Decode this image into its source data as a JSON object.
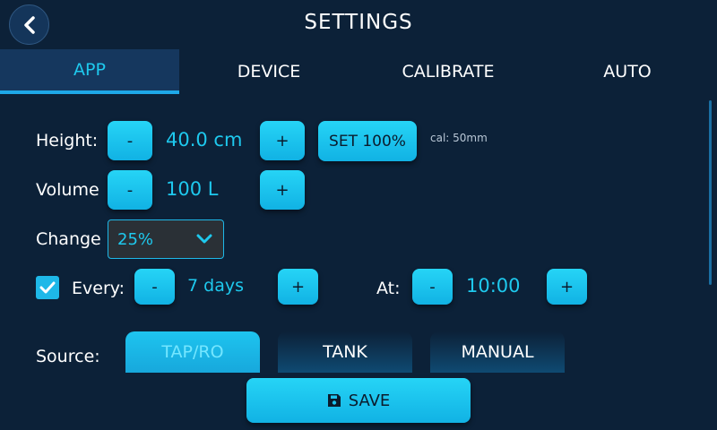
{
  "header": {
    "title": "SETTINGS",
    "back_icon": "chevron-left-icon"
  },
  "tabs": [
    {
      "label": "APP",
      "active": true
    },
    {
      "label": "DEVICE",
      "active": false
    },
    {
      "label": "CALIBRATE",
      "active": false
    },
    {
      "label": "AUTO",
      "active": false
    }
  ],
  "height": {
    "label": "Height:",
    "minus": "-",
    "value": "40.0 cm",
    "plus": "+",
    "set_label": "SET 100%",
    "cal_note": "cal: 50mm"
  },
  "volume": {
    "label": "Volume",
    "minus": "-",
    "value": "100 L",
    "plus": "+"
  },
  "change": {
    "label": "Change",
    "selected": "25%"
  },
  "every": {
    "checked": true,
    "label": "Every:",
    "minus": "-",
    "value": "7 days",
    "plus": "+"
  },
  "at": {
    "label": "At:",
    "minus": "-",
    "value": "10:00",
    "plus": "+"
  },
  "source": {
    "label": "Source:",
    "options": [
      "TAP/RO",
      "TANK",
      "MANUAL"
    ],
    "selected": "TAP/RO"
  },
  "save": {
    "label": "SAVE",
    "icon": "floppy-disk-icon"
  },
  "colors": {
    "background": "#0c2138",
    "accent": "#1ec9ee",
    "button": "#1ab8e8"
  }
}
